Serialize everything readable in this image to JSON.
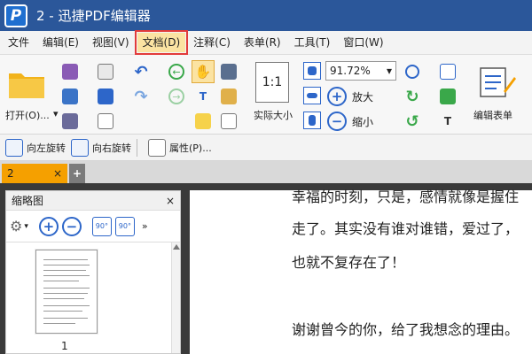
{
  "window": {
    "title": "2 - 迅捷PDF编辑器",
    "logo_letter": "P"
  },
  "menu": [
    "文件",
    "编辑(E)",
    "视图(V)",
    "文档(D)",
    "注释(C)",
    "表单(R)",
    "工具(T)",
    "窗口(W)"
  ],
  "menu_active": "文档(D)",
  "ribbon": {
    "open_label": "打开(O)...",
    "actual_size_label": "实际大小",
    "actual_size_glyph": "1:1",
    "zoom_value": "91.72%",
    "zoom_in_label": "放大",
    "zoom_out_label": "缩小",
    "edit_form_label": "编辑表单"
  },
  "subtoolbar": {
    "rotate_left": "向左旋转",
    "rotate_right": "向右旋转",
    "properties": "属性(P)..."
  },
  "tabs": [
    {
      "label": "2"
    }
  ],
  "thumbnail_panel": {
    "title": "缩略图",
    "page_number": "1"
  },
  "document": {
    "lines": [
      "幸福的时刻，只是，感情就像是握住",
      "走了。其实没有谁对谁错，爱过了，",
      "也就不复存在了！",
      "",
      "谢谢曾今的你，给了我想念的理由。"
    ]
  },
  "colors": {
    "title_bar": "#2b579a",
    "tab_active": "#f5a000",
    "accent_blue": "#2d66c9",
    "highlight_red": "#e23b3b"
  }
}
